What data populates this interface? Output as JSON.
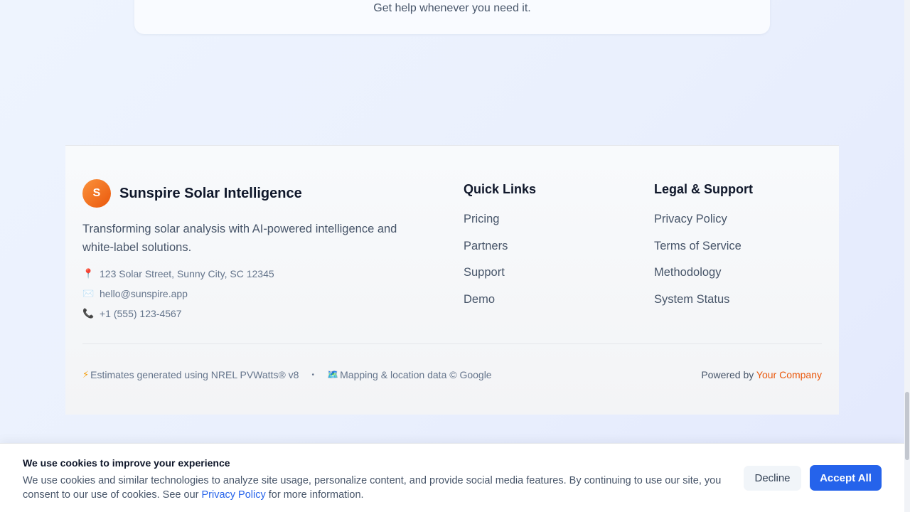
{
  "top_card": {
    "text": "Get help whenever you need it."
  },
  "brand": {
    "logo_letter": "S",
    "name": "Sunspire Solar Intelligence",
    "description": "Transforming solar analysis with AI-powered intelligence and white-label solutions."
  },
  "contact": [
    {
      "icon": "pin-icon",
      "glyph": "📍",
      "text": "123 Solar Street, Sunny City, SC 12345"
    },
    {
      "icon": "mail-icon",
      "glyph": "✉️",
      "text": "hello@sunspire.app"
    },
    {
      "icon": "phone-icon",
      "glyph": "📞",
      "text": "+1 (555) 123-4567"
    }
  ],
  "quick_links": {
    "title": "Quick Links",
    "items": [
      "Pricing",
      "Partners",
      "Support",
      "Demo"
    ]
  },
  "legal": {
    "title": "Legal & Support",
    "items": [
      "Privacy Policy",
      "Terms of Service",
      "Methodology",
      "System Status"
    ]
  },
  "bottom": {
    "estimates_icon": "⚡",
    "estimates": "Estimates generated using NREL PVWatts® v8",
    "separator": "•",
    "mapping_icon": "🗺️",
    "mapping": "Mapping & location data © Google",
    "powered_prefix": "Powered by ",
    "powered_link": "Your Company"
  },
  "cookie": {
    "title": "We use cookies to improve your experience",
    "text_before": "We use cookies and similar technologies to analyze site usage, personalize content, and provide social media features. By continuing to use our site, you consent to our use of cookies. See our ",
    "link": "Privacy Policy",
    "text_after": " for more information.",
    "decline": "Decline",
    "accept": "Accept All"
  },
  "colors": {
    "accent": "#ea580c",
    "primary_button": "#2563eb",
    "link": "#2563eb"
  }
}
